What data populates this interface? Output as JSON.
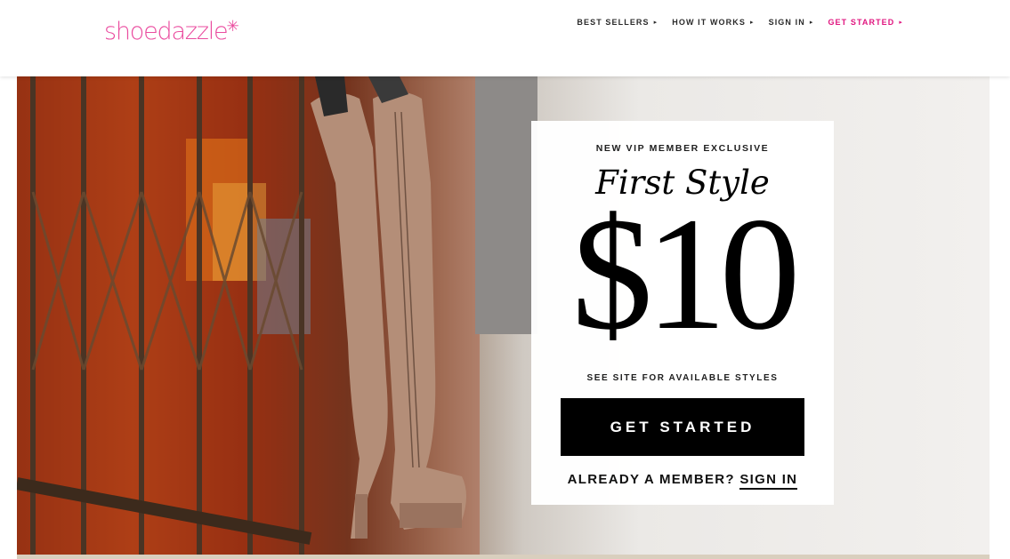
{
  "brand": {
    "logo_text": "shoedazzle",
    "logo_mark": "✳",
    "accent_color": "#ea4c9f"
  },
  "nav": {
    "items": [
      {
        "label": "BEST SELLERS",
        "arrow": "▸"
      },
      {
        "label": "HOW IT WORKS",
        "arrow": "▸"
      },
      {
        "label": "SIGN IN",
        "arrow": "▸"
      },
      {
        "label": "GET STARTED",
        "arrow": "▸"
      }
    ]
  },
  "hero": {
    "image_subject": "over-the-knee lace-up boots against graffiti wall and iron gate"
  },
  "promo": {
    "eyebrow": "NEW VIP MEMBER EXCLUSIVE",
    "headline": "First Style",
    "price": "$10",
    "disclaimer": "SEE SITE FOR AVAILABLE STYLES",
    "cta_label": "GET STARTED",
    "member_prompt": "ALREADY A MEMBER?",
    "signin_label": "SIGN IN"
  }
}
